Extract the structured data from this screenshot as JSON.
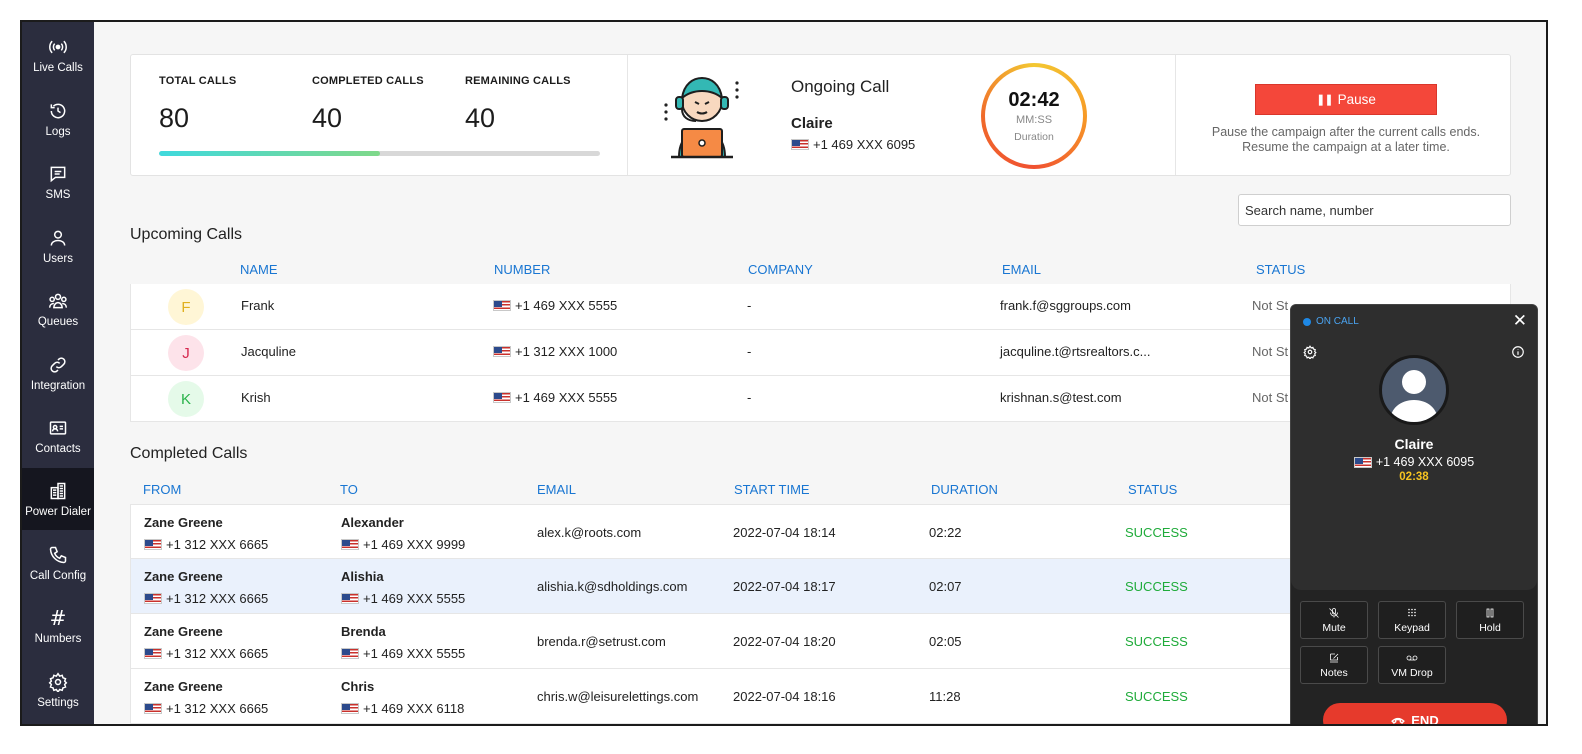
{
  "sidebar": {
    "items": [
      {
        "label": "Live Calls",
        "icon": "broadcast-icon"
      },
      {
        "label": "Logs",
        "icon": "history-icon"
      },
      {
        "label": "SMS",
        "icon": "message-icon"
      },
      {
        "label": "Users",
        "icon": "user-icon"
      },
      {
        "label": "Queues",
        "icon": "group-icon"
      },
      {
        "label": "Integration",
        "icon": "link-icon"
      },
      {
        "label": "Contacts",
        "icon": "contact-card-icon"
      },
      {
        "label": "Power Dialer",
        "icon": "building-icon",
        "active": true
      },
      {
        "label": "Call Config",
        "icon": "phone-icon"
      },
      {
        "label": "Numbers",
        "icon": "hash-icon",
        "glyph": "#"
      },
      {
        "label": "Settings",
        "icon": "gear-icon"
      }
    ]
  },
  "stats": {
    "total_label": "TOTAL CALLS",
    "total_value": "80",
    "completed_label": "COMPLETED CALLS",
    "completed_value": "40",
    "remaining_label": "REMAINING CALLS",
    "remaining_value": "40",
    "progress_fraction": 0.5
  },
  "ongoing": {
    "title": "Ongoing Call",
    "name": "Claire",
    "number": "+1 469 XXX 6095",
    "timer": "02:42",
    "timer_format": "MM:SS",
    "timer_caption": "Duration"
  },
  "pause": {
    "label": "Pause",
    "note_line1": "Pause the campaign after the current calls ends.",
    "note_line2": "Resume the campaign at a later time."
  },
  "search": {
    "placeholder": "Search name, number"
  },
  "upcoming": {
    "title": "Upcoming Calls",
    "headers": [
      "NAME",
      "NUMBER",
      "COMPANY",
      "EMAIL",
      "STATUS"
    ],
    "rows": [
      {
        "initial": "F",
        "name": "Frank",
        "number": "+1 469 XXX 5555",
        "company": "-",
        "email": "frank.f@sggroups.com",
        "status": "Not St"
      },
      {
        "initial": "J",
        "name": "Jacquline",
        "number": "+1 312 XXX 1000",
        "company": "-",
        "email": "jacquline.t@rtsrealtors.c...",
        "status": "Not St"
      },
      {
        "initial": "K",
        "name": "Krish",
        "number": "+1 469 XXX 5555",
        "company": "-",
        "email": "krishnan.s@test.com",
        "status": "Not St"
      }
    ],
    "avatar_colors": [
      {
        "bg": "#fff6d6",
        "fg": "#e0b020"
      },
      {
        "bg": "#fde3ea",
        "fg": "#d6294f"
      },
      {
        "bg": "#e5fae9",
        "fg": "#29b34a"
      }
    ]
  },
  "completed": {
    "title": "Completed Calls",
    "headers": [
      "FROM",
      "TO",
      "EMAIL",
      "START TIME",
      "DURATION",
      "STATUS"
    ],
    "rows": [
      {
        "from_name": "Zane Greene",
        "from_number": "+1 312 XXX 6665",
        "to_name": "Alexander",
        "to_number": "+1 469 XXX 9999",
        "email": "alex.k@roots.com",
        "start": "2022-07-04 18:14",
        "duration": "02:22",
        "status": "SUCCESS"
      },
      {
        "from_name": "Zane Greene",
        "from_number": "+1 312 XXX 6665",
        "to_name": "Alishia",
        "to_number": "+1 469 XXX 5555",
        "email": "alishia.k@sdholdings.com",
        "start": "2022-07-04 18:17",
        "duration": "02:07",
        "status": "SUCCESS"
      },
      {
        "from_name": "Zane Greene",
        "from_number": "+1 312 XXX 6665",
        "to_name": "Brenda",
        "to_number": "+1 469 XXX 5555",
        "email": "brenda.r@setrust.com",
        "start": "2022-07-04 18:20",
        "duration": "02:05",
        "status": "SUCCESS"
      },
      {
        "from_name": "Zane Greene",
        "from_number": "+1 312 XXX 6665",
        "to_name": "Chris",
        "to_number": "+1 469 XXX 6118",
        "email": "chris.w@leisurelettings.com",
        "start": "2022-07-04 18:16",
        "duration": "11:28",
        "status": "SUCCESS"
      }
    ]
  },
  "dialer": {
    "status": "ON CALL",
    "name": "Claire",
    "number": "+1 469 XXX 6095",
    "elapsed": "02:38",
    "buttons": [
      {
        "label": "Mute",
        "icon": "mic-off-icon"
      },
      {
        "label": "Keypad",
        "icon": "keypad-icon"
      },
      {
        "label": "Hold",
        "icon": "pause-icon"
      },
      {
        "label": "Notes",
        "icon": "edit-icon"
      },
      {
        "label": "VM Drop",
        "icon": "voicemail-icon"
      }
    ],
    "end_label": "END"
  },
  "colors": {
    "sidebar_bg": "#2b2d3e",
    "accent_blue": "#1976d2",
    "success_green": "#1fab3a",
    "danger_red": "#f4473a",
    "timer_yellow": "#f5c320"
  }
}
